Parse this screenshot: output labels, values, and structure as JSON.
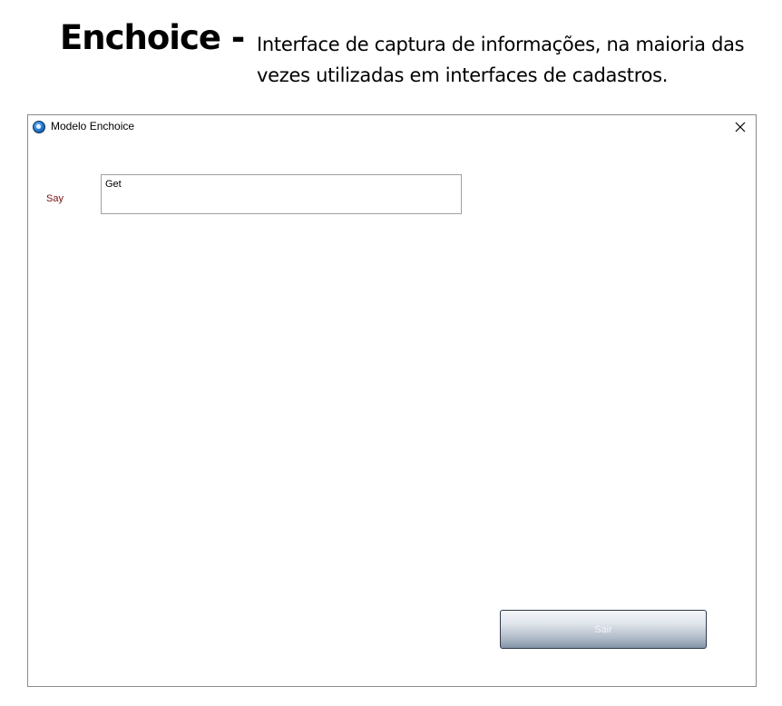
{
  "header": {
    "title": "Enchoice -",
    "description": "Interface de captura de informações, na maioria das vezes utilizadas em interfaces de cadastros."
  },
  "window": {
    "title": "Modelo Enchoice",
    "icon": "app-logo-icon",
    "close_icon": "close-icon"
  },
  "form": {
    "say_label": "Say",
    "get_value": "Get"
  },
  "actions": {
    "exit_label": "Sair"
  },
  "colors": {
    "label_color": "#7a1010",
    "button_gradient_bottom": "#8393a7"
  }
}
